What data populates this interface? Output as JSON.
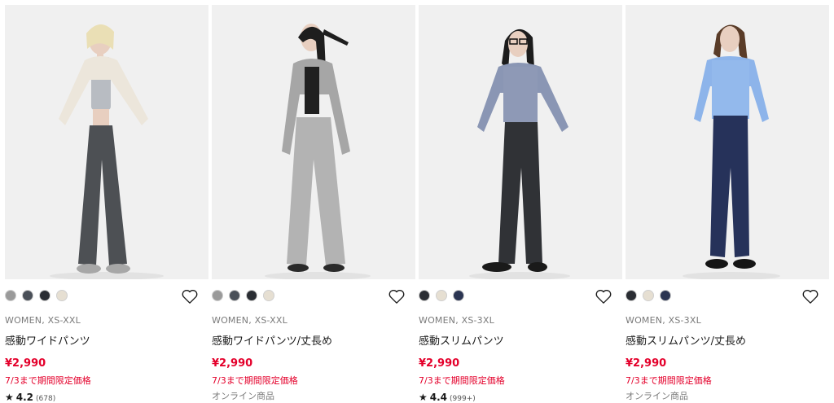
{
  "products": [
    {
      "meta": "WOMEN, XS-XXL",
      "name": "感動ワイドパンツ",
      "price": "¥2,990",
      "promo": "7/3まで期間限定価格",
      "rating_star": "★",
      "rating_score": "4.2",
      "rating_count": "(678)",
      "swatches": [
        "#9a9a9a",
        "#4a5058",
        "#2a2d33",
        "#e6dfd2"
      ],
      "image_icon": "model-wide-pants-icon"
    },
    {
      "meta": "WOMEN, XS-XXL",
      "name": "感動ワイドパンツ/丈長め",
      "price": "¥2,990",
      "promo": "7/3まで期間限定価格",
      "note": "オンライン商品",
      "swatches": [
        "#9a9a9a",
        "#4a5058",
        "#2a2d33",
        "#e6dfd2"
      ],
      "image_icon": "model-wide-pants-long-icon"
    },
    {
      "meta": "WOMEN, XS-3XL",
      "name": "感動スリムパンツ",
      "price": "¥2,990",
      "promo": "7/3まで期間限定価格",
      "rating_star": "★",
      "rating_score": "4.4",
      "rating_count": "(999+)",
      "swatches": [
        "#2a2d33",
        "#e6dfd2",
        "#2b3552"
      ],
      "image_icon": "model-slim-pants-icon"
    },
    {
      "meta": "WOMEN, XS-3XL",
      "name": "感動スリムパンツ/丈長め",
      "price": "¥2,990",
      "promo": "7/3まで期間限定価格",
      "note": "オンライン商品",
      "swatches": [
        "#2a2d33",
        "#e6dfd2",
        "#2b3552"
      ],
      "image_icon": "model-slim-pants-long-icon"
    }
  ],
  "colors": {
    "price": "#e4002b",
    "meta": "#7a7a7a",
    "image_bg": "#efefef"
  },
  "favorite_icon": "heart-outline-icon"
}
